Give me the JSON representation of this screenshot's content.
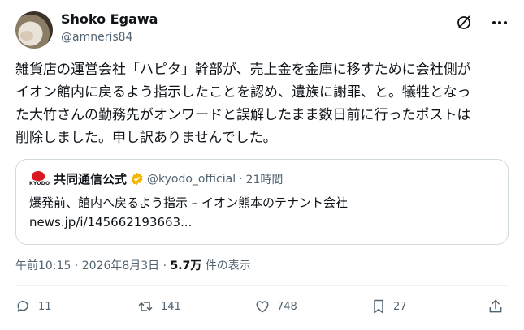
{
  "author": {
    "name": "Shoko Egawa",
    "handle": "@amneris84"
  },
  "tweet": {
    "lines": [
      "雑貨店の運営会社「ハピタ」幹部が、売上金を金庫に移すために会社側が",
      "イオン館内に戻るよう指示したことを認め、遺族に謝罪、と。犠牲となっ",
      "た大竹さんの勤務先がオンワードと誤解したまま数日前に行ったポストは",
      "削除しました。申し訳ありませんでした。"
    ]
  },
  "quote": {
    "logo_text": "KYODO",
    "name": "共同通信公式",
    "handle": "@kyodo_official",
    "sep": "·",
    "time": "21時間",
    "text": "爆発前、館内へ戻るよう指示 – イオン熊本のテナント会社",
    "link": "news.jp/i/145662193663..."
  },
  "meta": {
    "time": "午前10:15",
    "sep1": "·",
    "date": "2026年8月3日",
    "sep2": "·",
    "views": "5.7万",
    "views_label": "件の表示"
  },
  "actions": {
    "replies": "11",
    "reposts": "141",
    "likes": "748",
    "bookmarks": "27"
  },
  "colors": {
    "text": "#0f1419",
    "secondary": "#536471",
    "verified": "#f4b400",
    "kyodo_red": "#d71920"
  }
}
